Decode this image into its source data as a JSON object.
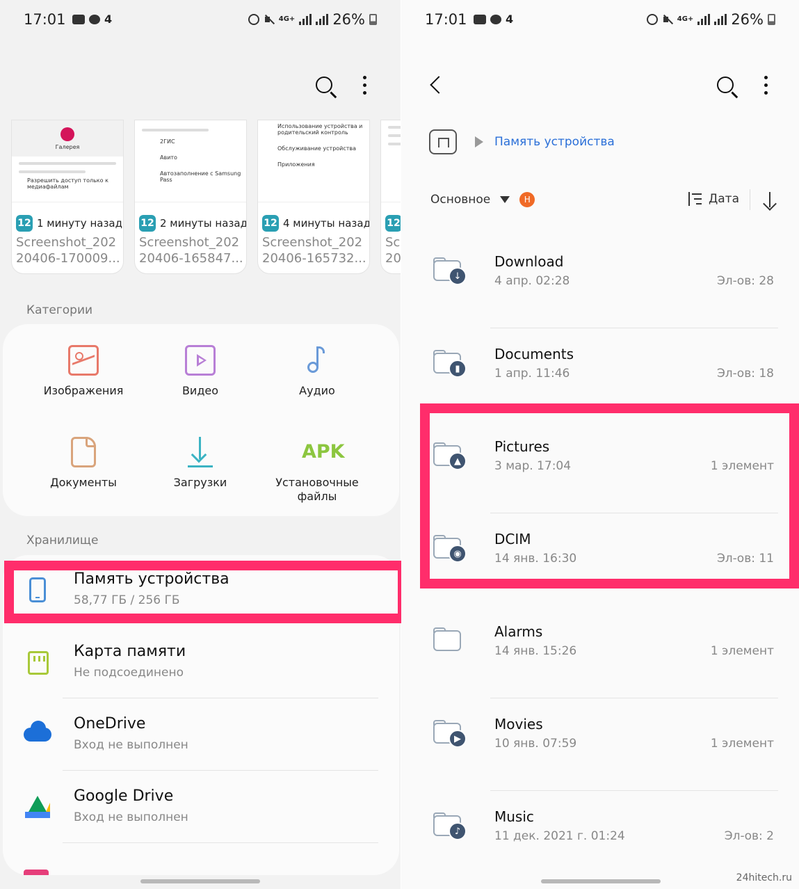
{
  "status_bar": {
    "time": "17:01",
    "network": "4G+",
    "battery": "26%"
  },
  "left": {
    "recent": [
      {
        "time": "1 минуту назад",
        "name_line1": "Screenshot_202",
        "name_line2": "20406-170009...",
        "thumb_title": "Галерея",
        "thumb_text1": "Разрешить доступ только к медиафайлам"
      },
      {
        "time": "2 минуты назад",
        "name_line1": "Screenshot_202",
        "name_line2": "20406-165847...",
        "thumb_items": [
          "2ГИС",
          "Авито",
          "Автозаполнение с Samsung Pass"
        ]
      },
      {
        "time": "4 минуты назад",
        "name_line1": "Screenshot_202",
        "name_line2": "20406-165732...",
        "thumb_items": [
          "Использование устройства и родительский контроль",
          "Обслуживание устройства",
          "Приложения"
        ]
      },
      {
        "time": "",
        "name_line1": "Sc",
        "name_line2": "20"
      }
    ],
    "categories_label": "Категории",
    "categories": [
      {
        "label": "Изображения",
        "icon": "image-icon",
        "color": "#e8796a"
      },
      {
        "label": "Видео",
        "icon": "video-icon",
        "color": "#b87fd6"
      },
      {
        "label": "Аудио",
        "icon": "music-note-icon",
        "color": "#6a9ad8"
      },
      {
        "label": "Документы",
        "icon": "document-icon",
        "color": "#d9a47c"
      },
      {
        "label": "Загрузки",
        "icon": "download-icon",
        "color": "#3bb3c3"
      },
      {
        "label_line1": "Установочные",
        "label_line2": "файлы",
        "icon_text": "APK",
        "color": "#8cc63f"
      }
    ],
    "storage_label": "Хранилище",
    "storage": [
      {
        "title": "Память устройства",
        "sub": "58,77 ГБ / 256 ГБ",
        "icon": "phone-icon"
      },
      {
        "title": "Карта памяти",
        "sub": "Не подсоединено",
        "icon": "sd-card-icon"
      },
      {
        "title": "OneDrive",
        "sub": "Вход не выполнен",
        "icon": "onedrive-icon"
      },
      {
        "title": "Google Drive",
        "sub": "Вход не выполнен",
        "icon": "google-drive-icon"
      }
    ],
    "highlight_color": "#ff2d6b"
  },
  "right": {
    "breadcrumb": "Память устройства",
    "filter_label": "Основное",
    "user_badge": "Н",
    "sort_label": "Дата",
    "folders": [
      {
        "name": "Download",
        "date": "4 апр. 02:28",
        "count": "Эл-ов: 28",
        "badge": "download-icon"
      },
      {
        "name": "Documents",
        "date": "1 апр. 11:46",
        "count": "Эл-ов: 18",
        "badge": "document-icon"
      },
      {
        "name": "Pictures",
        "date": "3 мар. 17:04",
        "count": "1 элемент",
        "badge": "image-icon"
      },
      {
        "name": "DCIM",
        "date": "14 янв. 16:30",
        "count": "Эл-ов: 11",
        "badge": "camera-icon"
      },
      {
        "name": "Alarms",
        "date": "14 янв. 15:26",
        "count": "1 элемент",
        "badge": ""
      },
      {
        "name": "Movies",
        "date": "10 янв. 07:59",
        "count": "1 элемент",
        "badge": "play-icon"
      },
      {
        "name": "Music",
        "date": "11 дек. 2021 г. 01:24",
        "count": "Эл-ов: 2",
        "badge": "music-note-icon"
      }
    ]
  },
  "watermark": "24hitech.ru"
}
